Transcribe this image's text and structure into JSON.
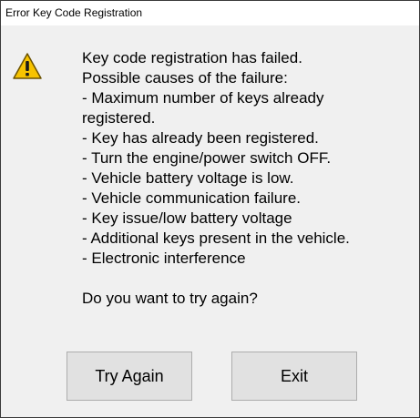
{
  "window": {
    "title": "Error Key Code Registration"
  },
  "dialog": {
    "icon": "warning-icon",
    "message_lines": [
      "Key code registration has failed.",
      "Possible causes of the failure:",
      "- Maximum number of keys already",
      "registered.",
      "- Key has already been registered.",
      "- Turn the engine/power switch OFF.",
      "- Vehicle battery voltage is low.",
      "- Vehicle communication failure.",
      "- Key issue/low battery voltage",
      "- Additional keys present in the vehicle.",
      "- Electronic interference"
    ],
    "question": "Do you want to try again?"
  },
  "buttons": {
    "try_again_label": "Try Again",
    "exit_label": "Exit"
  },
  "colors": {
    "dialog_background": "#f0f0f0",
    "titlebar_background": "#ffffff",
    "button_background": "#e1e1e1",
    "button_border": "#adadad",
    "warning_fill": "#f7c300",
    "warning_outline": "#6b5200"
  }
}
